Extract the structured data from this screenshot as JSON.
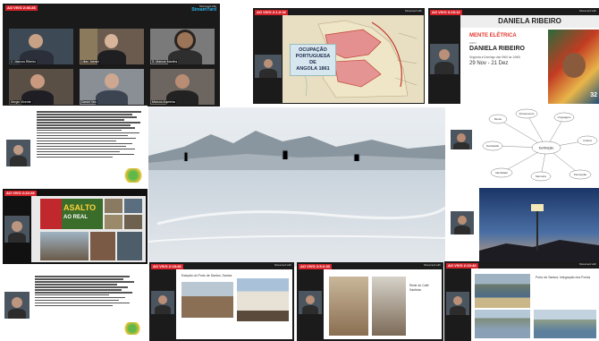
{
  "tiles": {
    "meeting": {
      "badge": "AO VIVO 2:46:28",
      "streamed_by": "Streamed with",
      "brand": "StreamYard",
      "participants": [
        "C. Marcos Ribeiro",
        "Lilian Jaimini",
        "S. Marcos Martins",
        "Sergio Vicente",
        "Daniel Veo",
        "Marcos Anjeleira"
      ]
    },
    "angola": {
      "badge": "AO VIVO 2:1:2:32",
      "streamed_by": "Streamed with",
      "title_line1": "OCUPAÇÃO",
      "title_line2": "PORTUGUESA DE",
      "title_line3": "ANGOLA 1861"
    },
    "daniela": {
      "badge": "AO VIVO 3:15:12",
      "streamed_by": "Streamed with",
      "header": "DANIELA RIBEIRO",
      "event": "MENTE ELÉTRICA",
      "with": "com",
      "name": "DANIELA RIBEIRO",
      "schedule": "Segunda a Domingo das 9h00 às 14h00",
      "dates": "29 Nov - 21 Dez",
      "counter": "32"
    },
    "bullets": {
      "lines": 8
    },
    "mindmap": {
      "center": "Definição",
      "nodes": [
        "Mente",
        "Pensamento",
        "Linguagem",
        "Cultura",
        "Sociedade",
        "Identidade",
        "Memória",
        "Percepção"
      ]
    },
    "asalto": {
      "badge": "AO VIVO 2:22:28",
      "title": "ASALTO",
      "subtitle": "AO REAL"
    },
    "santos": {
      "badge": "AO VIVO 2:18:48",
      "streamed_by": "Streamed with",
      "caption": "Estação do Porto de Santos, Santos"
    },
    "building": {
      "badge": "AO VIVO 2:5:2:33",
      "streamed_by": "Streamed with",
      "caption": "Rede do Café Santista"
    },
    "port": {
      "badge": "AO VIVO 2:10:46",
      "streamed_by": "Streamed with",
      "caption": "Porto de Santos: Integração dos Portos"
    }
  },
  "colors": {
    "live_red": "#d8232a",
    "brand_red": "#e2392f"
  }
}
